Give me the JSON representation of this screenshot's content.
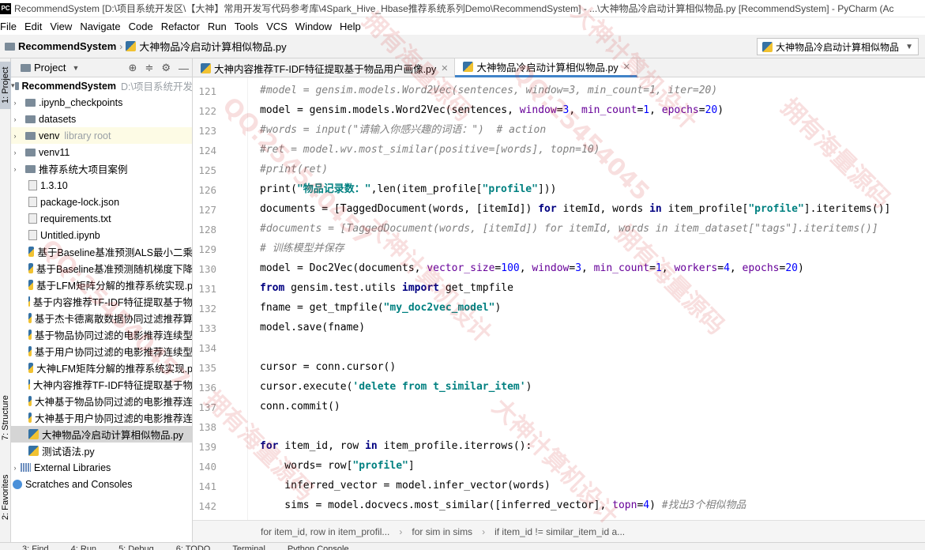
{
  "window": {
    "title": "RecommendSystem [D:\\项目系统开发区\\【大神】常用开发写代码参考库\\4Spark_Hive_Hbase推荐系统系列Demo\\RecommendSystem] - ...\\大神物品冷启动计算相似物品.py [RecommendSystem] - PyCharm (Ac",
    "app_icon": "PC"
  },
  "menu": [
    "File",
    "Edit",
    "View",
    "Navigate",
    "Code",
    "Refactor",
    "Run",
    "Tools",
    "VCS",
    "Window",
    "Help"
  ],
  "navbar": {
    "project": "RecommendSystem",
    "file": "大神物品冷启动计算相似物品.py",
    "run_config": "大神物品冷启动计算相似物品"
  },
  "side_tabs": {
    "project": "1: Project",
    "structure": "7: Structure",
    "favorites": "2: Favorites"
  },
  "project_panel": {
    "title": "Project",
    "root": {
      "name": "RecommendSystem",
      "path": "D:\\项目系统开发"
    },
    "items": [
      {
        "name": ".ipynb_checkpoints",
        "type": "folder"
      },
      {
        "name": "datasets",
        "type": "folder"
      },
      {
        "name": "venv",
        "type": "folder",
        "note": "library root"
      },
      {
        "name": "venv11",
        "type": "folder"
      },
      {
        "name": "推荐系统大项目案例",
        "type": "folder"
      },
      {
        "name": "1.3.10",
        "type": "file"
      },
      {
        "name": "package-lock.json",
        "type": "file"
      },
      {
        "name": "requirements.txt",
        "type": "file"
      },
      {
        "name": "Untitled.ipynb",
        "type": "file"
      },
      {
        "name": "基于Baseline基准预测ALS最小二乘",
        "type": "py"
      },
      {
        "name": "基于Baseline基准预测随机梯度下降",
        "type": "py"
      },
      {
        "name": "基于LFM矩阵分解的推荐系统实现.p",
        "type": "py"
      },
      {
        "name": "基于内容推荐TF-IDF特征提取基于物",
        "type": "py"
      },
      {
        "name": "基于杰卡德离散数据协同过滤推荐算",
        "type": "py"
      },
      {
        "name": "基于物品协同过滤的电影推荐连续型",
        "type": "py"
      },
      {
        "name": "基于用户协同过滤的电影推荐连续型",
        "type": "py"
      },
      {
        "name": "大神LFM矩阵分解的推荐系统实现.p",
        "type": "py"
      },
      {
        "name": "大神内容推荐TF-IDF特征提取基于物",
        "type": "py"
      },
      {
        "name": "大神基于物品协同过滤的电影推荐连",
        "type": "py"
      },
      {
        "name": "大神基于用户协同过滤的电影推荐连",
        "type": "py"
      },
      {
        "name": "大神物品冷启动计算相似物品.py",
        "type": "py",
        "selected": true
      },
      {
        "name": "测试语法.py",
        "type": "py"
      }
    ],
    "external_libraries": "External Libraries",
    "scratches": "Scratches and Consoles"
  },
  "tabs": [
    {
      "label": "大神内容推荐TF-IDF特征提取基于物品用户画像.py",
      "active": false
    },
    {
      "label": "大神物品冷启动计算相似物品.py",
      "active": true
    }
  ],
  "editor": {
    "line_numbers": [
      "121",
      "122",
      "123",
      "124",
      "125",
      "126",
      "127",
      "128",
      "129",
      "130",
      "131",
      "132",
      "133",
      "134",
      "135",
      "136",
      "137",
      "138",
      "139",
      "140",
      "141",
      "142"
    ],
    "lines": [
      "#model = gensim.models.Word2Vec(sentences, window=3, min_count=1, iter=20)",
      "model = gensim.models.Word2Vec(sentences, window=3, min_count=1, epochs=20)",
      "#words = input(\"请输入你感兴趣的词语：\")  # action",
      "#ret = model.wv.most_similar(positive=[words], topn=10)",
      "#print(ret)",
      "print(\"物品记录数：\",len(item_profile[\"profile\"]))",
      "documents = [TaggedDocument(words, [itemId]) for itemId, words in item_profile[\"profile\"].iteritems()]",
      "#documents = [TaggedDocument(words, [itemId]) for itemId, words in item_dataset[\"tags\"].iteritems()]",
      "# 训练模型并保存",
      "model = Doc2Vec(documents, vector_size=100, window=3, min_count=1, workers=4, epochs=20)",
      "from gensim.test.utils import get_tmpfile",
      "fname = get_tmpfile(\"my_doc2vec_model\")",
      "model.save(fname)",
      "",
      "cursor = conn.cursor()",
      "cursor.execute('delete from t_similar_item')",
      "conn.commit()",
      "",
      "for item_id, row in item_profile.iterrows():",
      "    words= row[\"profile\"]",
      "    inferred_vector = model.infer_vector(words)",
      "    sims = model.docvecs.most_similar([inferred_vector], topn=4) #找出3个相似物品"
    ]
  },
  "breadcrumb": [
    "for item_id, row in item_profil...",
    "for sim in sims",
    "if item_id != similar_item_id a..."
  ],
  "bottom_tools": [
    "3: Find",
    "4: Run",
    "5: Debug",
    "6: TODO",
    "Terminal",
    "Python Console"
  ],
  "watermarks": [
    "拥有海量源码",
    "QQ:25454045",
    "大神计算机设计",
    "拥有海量源码",
    "QQ:254540457",
    "大神计算机设计",
    "拥有海量源码",
    "QQ:254540457",
    "大神计算机设计",
    "拥有海量源码"
  ]
}
